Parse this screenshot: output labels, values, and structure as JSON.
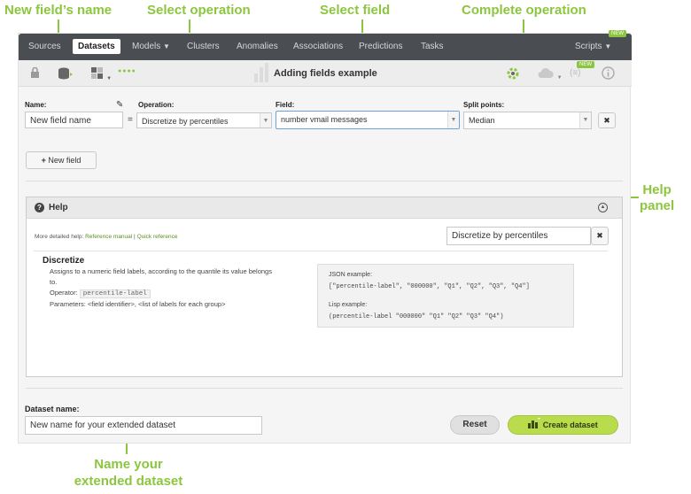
{
  "annotations": {
    "new_field_name": "New field’s name",
    "select_operation": "Select operation",
    "select_field": "Select field",
    "complete_operation": "Complete operation",
    "help_panel_line1": "Help",
    "help_panel_line2": "panel",
    "name_dataset_line1": "Name your",
    "name_dataset_line2": "extended dataset"
  },
  "colors": {
    "accent_green": "#8cc63f",
    "navbar_bg": "#4a4d52"
  },
  "navbar": {
    "items": [
      "Sources",
      "Datasets",
      "Models",
      "Clusters",
      "Anomalies",
      "Associations",
      "Predictions",
      "Tasks"
    ],
    "active": "Datasets",
    "scripts": "Scripts",
    "new_badge": "NEW"
  },
  "toolbar": {
    "title": "Adding fields example",
    "icons": [
      "lock-icon",
      "database-icon",
      "field-type-icon",
      "dots-icon",
      "chart-icon",
      "gear-icon",
      "cloud-icon",
      "formula-icon",
      "info-icon"
    ],
    "dots": "●●●●",
    "new_badge": "NEW"
  },
  "form": {
    "name_label": "Name:",
    "name_value": "New field name",
    "equals": "=",
    "operation_label": "Operation:",
    "operation_value": "Discretize by percentiles",
    "field_label": "Field:",
    "field_value": "number vmail messages",
    "split_label": "Split points:",
    "split_value": "Median",
    "remove_icon": "✖",
    "new_field_button": "New field"
  },
  "help": {
    "title": "Help",
    "more_text": "More detailed help:",
    "reference_manual": "Reference manual",
    "quick_reference": "Quick reference",
    "search_value": "Discretize by percentiles",
    "clear_icon": "✖",
    "heading": "Discretize",
    "desc_line1": "Assigns to a numeric field labels, according to the quantile its value belongs",
    "desc_line2": "to.",
    "operator_label": "Operator:",
    "operator_code": "percentile-label",
    "parameters": "Parameters: <field identifier>, <list of labels for each group>",
    "json_title": "JSON example:",
    "json_code": "[\"percentile-label\", \"000000\", \"Q1\", \"Q2\", \"Q3\", \"Q4\"]",
    "lisp_title": "Lisp example:",
    "lisp_code": "(percentile-label \"000000\" \"Q1\" \"Q2\" \"Q3\" \"Q4\")"
  },
  "dataset": {
    "label": "Dataset name:",
    "value": "New name for your extended dataset",
    "reset_button": "Reset",
    "create_button": "Create dataset"
  }
}
